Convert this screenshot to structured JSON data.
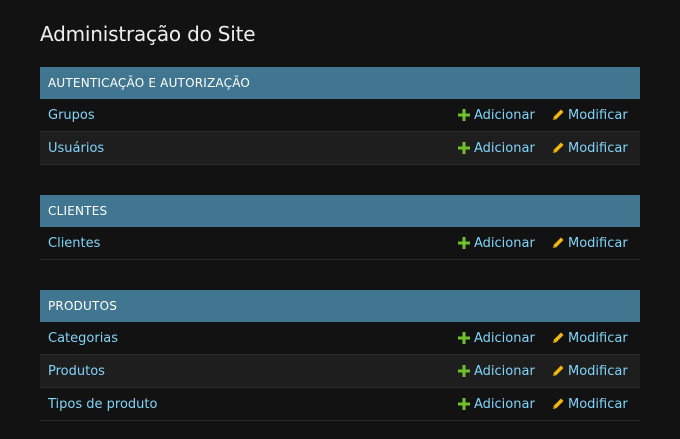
{
  "page": {
    "title": "Administração do Site"
  },
  "modules": [
    {
      "header": "AUTENTICAÇÃO E AUTORIZAÇÃO",
      "rows": [
        {
          "label": "Grupos",
          "add": "Adicionar",
          "change": "Modificar"
        },
        {
          "label": "Usuários",
          "add": "Adicionar",
          "change": "Modificar"
        }
      ]
    },
    {
      "header": "CLIENTES",
      "rows": [
        {
          "label": "Clientes",
          "add": "Adicionar",
          "change": "Modificar"
        }
      ]
    },
    {
      "header": "PRODUTOS",
      "rows": [
        {
          "label": "Categorias",
          "add": "Adicionar",
          "change": "Modificar"
        },
        {
          "label": "Produtos",
          "add": "Adicionar",
          "change": "Modificar"
        },
        {
          "label": "Tipos de produto",
          "add": "Adicionar",
          "change": "Modificar"
        }
      ]
    }
  ],
  "colors": {
    "background": "#121212",
    "module_header": "#417690",
    "link": "#81d4fa",
    "add_icon": "#70bf2b",
    "change_icon": "#efb80b"
  },
  "icons": {
    "add": "plus-icon",
    "change": "pencil-icon"
  }
}
